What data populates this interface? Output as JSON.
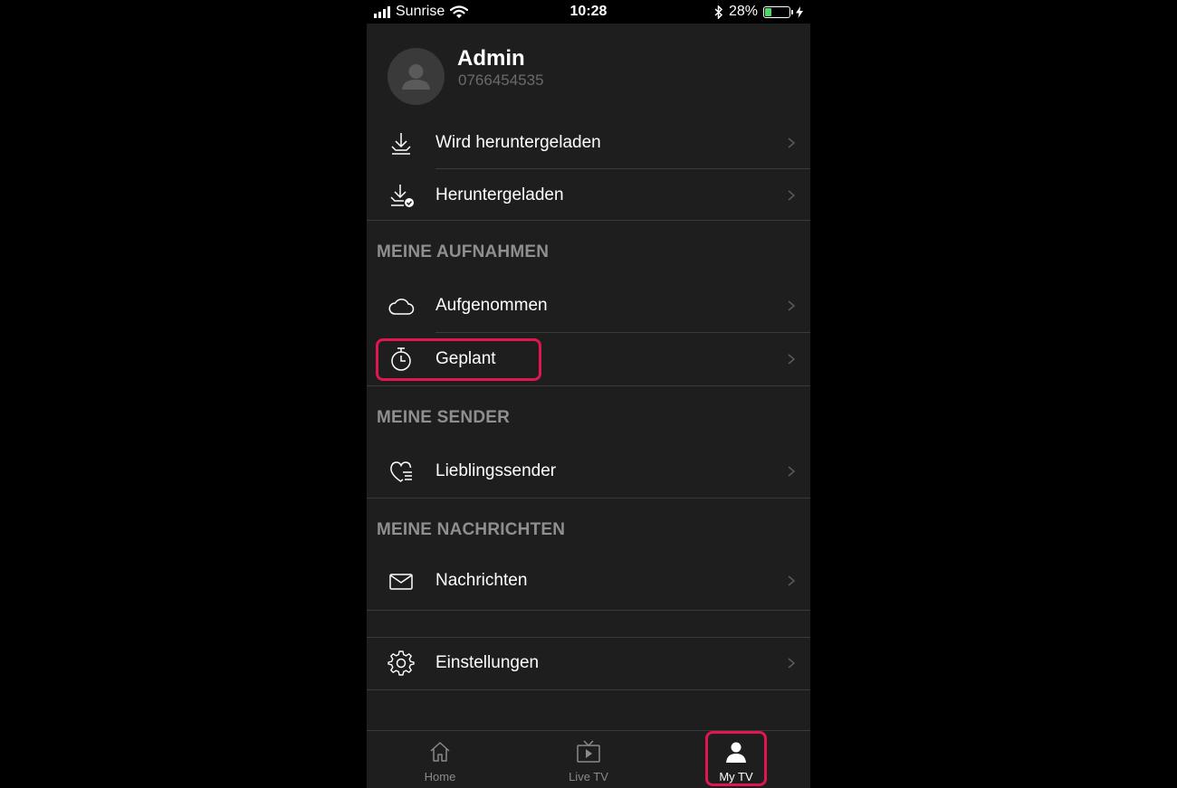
{
  "status_bar": {
    "carrier": "Sunrise",
    "time": "10:28",
    "battery_percent": "28%",
    "battery_level": 0.28,
    "battery_color": "#4cd964"
  },
  "profile": {
    "name": "Admin",
    "phone": "0766454535",
    "avatar_icon": "user-silhouette-icon"
  },
  "downloads": [
    {
      "label": "Wird heruntergeladen",
      "icon": "download-icon"
    },
    {
      "label": "Heruntergeladen",
      "icon": "downloaded-check-icon"
    }
  ],
  "sections": {
    "recordings": {
      "title": "MEINE AUFNAHMEN",
      "items": [
        {
          "label": "Aufgenommen",
          "icon": "cloud-icon"
        },
        {
          "label": "Geplant",
          "icon": "stopwatch-icon",
          "highlighted": true
        }
      ]
    },
    "channels": {
      "title": "MEINE SENDER",
      "items": [
        {
          "label": "Lieblingssender",
          "icon": "heart-list-icon"
        }
      ]
    },
    "messages": {
      "title": "MEINE NACHRICHTEN",
      "items": [
        {
          "label": "Nachrichten",
          "icon": "envelope-icon"
        }
      ]
    }
  },
  "settings": {
    "label": "Einstellungen",
    "icon": "gear-icon"
  },
  "tabbar": {
    "tabs": [
      {
        "label": "Home",
        "icon": "home-icon",
        "active": false
      },
      {
        "label": "Live TV",
        "icon": "tv-play-icon",
        "active": false
      },
      {
        "label": "My TV",
        "icon": "person-icon",
        "active": true,
        "highlighted": true
      }
    ]
  },
  "colors": {
    "background": "#1e1e1e",
    "highlight": "#e0164e",
    "section_title": "#8f8f8f",
    "divider": "#3a3a3a"
  }
}
